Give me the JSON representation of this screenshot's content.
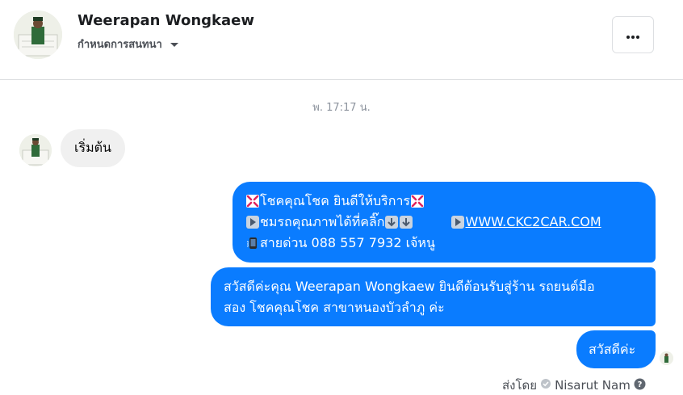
{
  "header": {
    "contact_name": "Weerapan Wongkaew",
    "settings_label": "กำหนดการสนทนา",
    "more_label": "···"
  },
  "thread": {
    "timestamp": "พ. 17:17 น.",
    "incoming": {
      "text": "เริ่มต้น"
    },
    "outgoing": [
      {
        "line1": "โชคคุณโชค ยินดีให้บริการ",
        "line2": "ชมรถคุณภาพได้ที่คลิ๊ก",
        "link": "WWW.CKC2CAR.COM",
        "line3": "สายด่วน 088 557 7932 เจ้หนู"
      },
      {
        "line1": "สวัสดีค่ะคุณ Weerapan Wongkaew ยินดีต้อนรับสู่ร้าน รถยนต์มือ",
        "line2": "สอง โชคคุณโชค สาขาหนองบัวลำภู ค่ะ"
      },
      {
        "text": "สวัสดีค่ะ"
      }
    ],
    "sent_by_label": "ส่งโดย",
    "sender_name": "Nisarut Nam"
  },
  "colors": {
    "outgoing_bubble": "#0a7cff",
    "incoming_bubble": "#f0f0f0",
    "muted_text": "#8d949e"
  },
  "icons": [
    "anger-symbol-emoji",
    "play-button-emoji",
    "down-arrow-emoji",
    "mobile-phone-emoji",
    "caret-down-icon",
    "more-dots-icon",
    "verified-check-icon",
    "help-question-icon"
  ]
}
